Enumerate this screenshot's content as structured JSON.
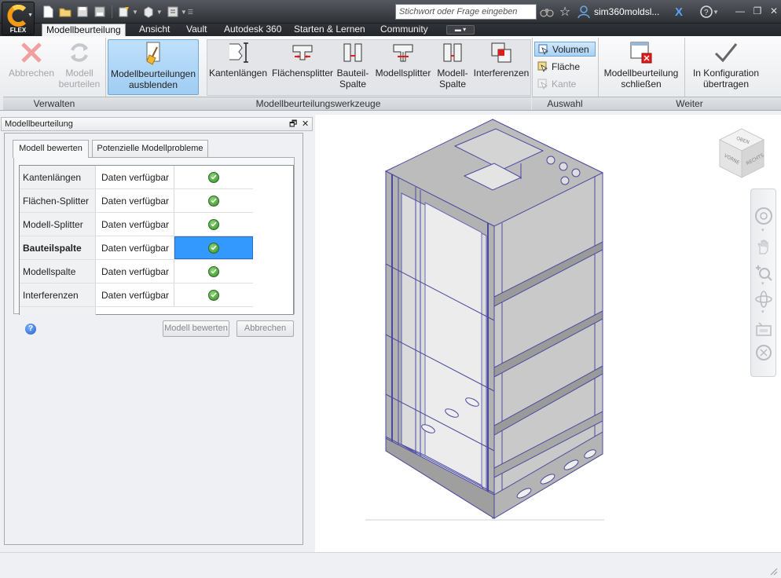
{
  "app": {
    "logo_letter": "C",
    "logo_caption": "FLEX",
    "search_placeholder": "Stichwort oder Frage eingeben",
    "user_name": "sim360moldsl..."
  },
  "tabs": [
    {
      "label": "Modellbeurteilung",
      "active": true
    },
    {
      "label": "Ansicht"
    },
    {
      "label": "Vault"
    },
    {
      "label": "Autodesk 360"
    },
    {
      "label": "Starten & Lernen"
    },
    {
      "label": "Community"
    }
  ],
  "ribbon": {
    "panels": {
      "verwalten": "Verwalten",
      "werkzeuge": "Modellbeurteilungswerkzeuge",
      "auswahl": "Auswahl",
      "weiter": "Weiter"
    },
    "buttons": {
      "abbrechen": [
        "Abbrechen"
      ],
      "modell_beurteilen": [
        "Modell",
        "beurteilen"
      ],
      "ausblenden": [
        "Modellbeurteilungen",
        "ausblenden"
      ],
      "kantenlaengen": [
        "Kantenlängen"
      ],
      "flaechensplitter": [
        "Flächensplitter"
      ],
      "bauteil_spalte": [
        "Bauteil-",
        "Spalte"
      ],
      "modellsplitter": [
        "Modellsplitter"
      ],
      "modell_spalte": [
        "Modell-",
        "Spalte"
      ],
      "interferenzen": [
        "Interferenzen"
      ],
      "schliessen": [
        "Modellbeurteilung",
        "schließen"
      ],
      "konfiguration": [
        "In Konfiguration",
        "übertragen"
      ]
    },
    "auswahl": {
      "volumen": "Volumen",
      "flaeche": "Fläche",
      "kante": "Kante"
    }
  },
  "browser": {
    "title": "Modellbeurteilung",
    "tabs": [
      "Modell bewerten",
      "Potenzielle Modellprobleme"
    ],
    "rows": [
      {
        "name": "Kantenlängen",
        "status": "Daten verfügbar"
      },
      {
        "name": "Flächen-Splitter",
        "status": "Daten verfügbar"
      },
      {
        "name": "Modell-Splitter",
        "status": "Daten verfügbar"
      },
      {
        "name": "Bauteilspalte",
        "status": "Daten verfügbar",
        "selected": true
      },
      {
        "name": "Modellspalte",
        "status": "Daten verfügbar"
      },
      {
        "name": "Interferenzen",
        "status": "Daten verfügbar"
      }
    ],
    "buttons": {
      "bewerten": "Modell bewerten",
      "abbrechen": "Abbrechen"
    }
  },
  "viewcube": {
    "top": "OBEN",
    "front": "VORNE",
    "right": "RECHTS"
  },
  "colors": {
    "selection": "#3399ff",
    "ribbon_selected": "#9fcdf3",
    "model_edges": "#4a4aa0"
  }
}
